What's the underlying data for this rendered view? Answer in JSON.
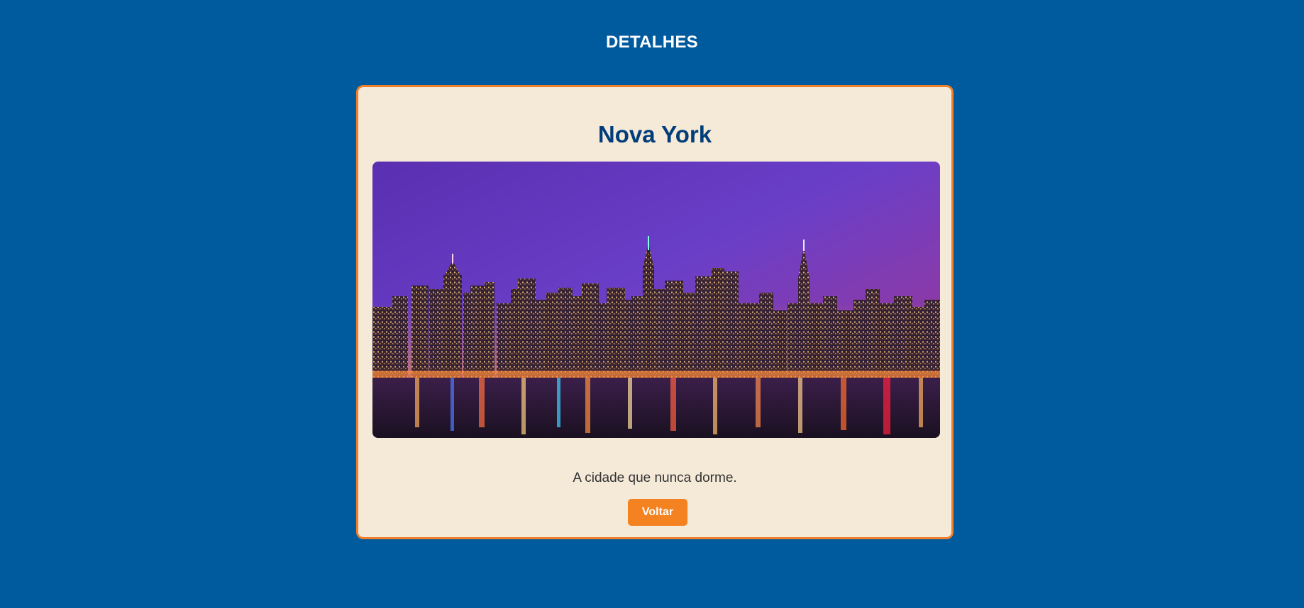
{
  "header": {
    "title": "DETALHES"
  },
  "card": {
    "title": "Nova York",
    "image_alt": "Nova York",
    "description": "A cidade que nunca dorme.",
    "back_label": "Voltar"
  },
  "colors": {
    "background": "#005a9e",
    "card_background": "#f5e9d8",
    "card_border": "#ef7f2b",
    "title": "#003d7a",
    "button": "#f58220"
  }
}
